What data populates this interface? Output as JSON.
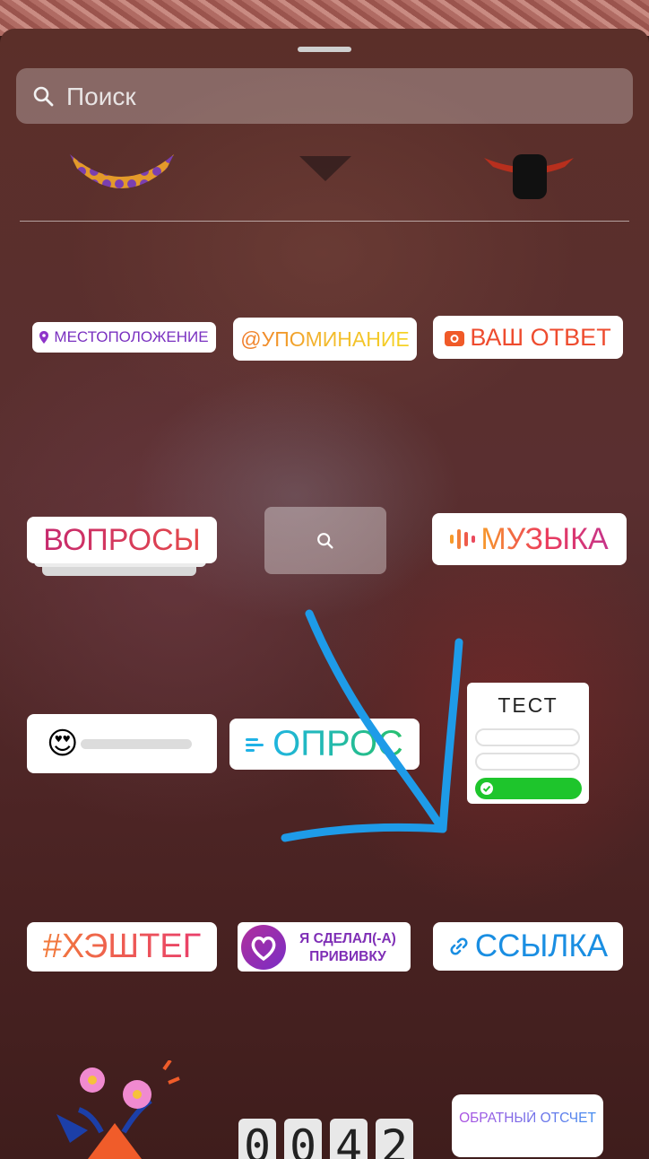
{
  "search": {
    "placeholder": "Поиск"
  },
  "stickers": {
    "location": "МЕСТОПОЛОЖЕНИЕ",
    "mention": "@УПОМИНАНИЕ",
    "your_answer": "ВАШ ОТВЕТ",
    "questions": "ВОПРОСЫ",
    "music": "МУЗЫКА",
    "poll": "ОПРОС",
    "quiz": {
      "title": "ТЕСТ"
    },
    "hashtag": "#ХЭШТЕГ",
    "vaccine": {
      "line1": "Я СДЕЛАЛ(-А)",
      "line2": "ПРИВИВКУ"
    },
    "link": "ССЫЛКА",
    "countdown": "ОБРАТНЫЙ ОТСЧЕТ",
    "clock_digits": [
      "0",
      "0",
      "4",
      "2"
    ]
  },
  "emoji": {
    "slider": "😍"
  },
  "colors": {
    "annotation_arrow": "#1e9be8",
    "quiz_correct": "#1ec52c"
  },
  "icons": [
    "search-icon",
    "location-pin-icon",
    "camera-icon",
    "gif-search-icon",
    "music-bars-icon",
    "poll-lines-icon",
    "check-icon",
    "heart-badge-icon",
    "link-chain-icon"
  ]
}
